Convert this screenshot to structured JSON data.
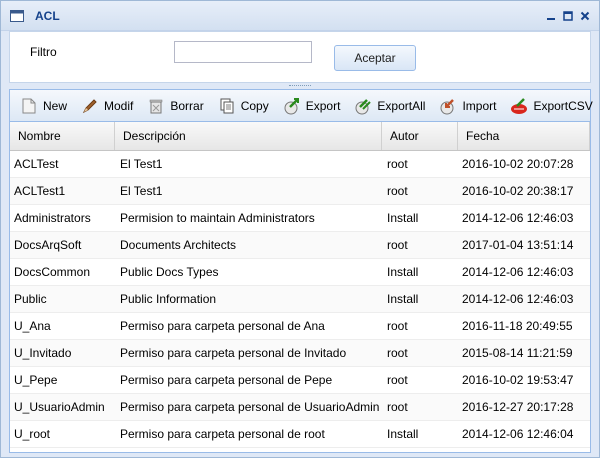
{
  "window": {
    "title": "ACL"
  },
  "filter": {
    "label": "Filtro",
    "value": "",
    "accept_label": "Aceptar"
  },
  "toolbar": {
    "buttons": [
      {
        "label": "New",
        "icon": "new-document-icon"
      },
      {
        "label": "Modif",
        "icon": "pencil-icon"
      },
      {
        "label": "Borrar",
        "icon": "delete-icon"
      },
      {
        "label": "Copy",
        "icon": "copy-icon"
      },
      {
        "label": "Export",
        "icon": "export-icon"
      },
      {
        "label": "ExportAll",
        "icon": "export-all-icon"
      },
      {
        "label": "Import",
        "icon": "import-icon"
      },
      {
        "label": "ExportCSV",
        "icon": "export-csv-icon"
      }
    ]
  },
  "grid": {
    "columns": [
      "Nombre",
      "Descripción",
      "Autor",
      "Fecha"
    ],
    "rows": [
      [
        "ACLTest",
        "El Test1",
        "root",
        "2016-10-02 20:07:28"
      ],
      [
        "ACLTest1",
        "El Test1",
        "root",
        "2016-10-02 20:38:17"
      ],
      [
        "Administrators",
        "Permision to maintain Administrators",
        "Install",
        "2014-12-06 12:46:03"
      ],
      [
        "DocsArqSoft",
        "Documents Architects",
        "root",
        "2017-01-04 13:51:14"
      ],
      [
        "DocsCommon",
        "Public Docs Types",
        "Install",
        "2014-12-06 12:46:03"
      ],
      [
        "Public",
        "Public Information",
        "Install",
        "2014-12-06 12:46:03"
      ],
      [
        "U_Ana",
        "Permiso para carpeta personal de Ana",
        "root",
        "2016-11-18 20:49:55"
      ],
      [
        "U_Invitado",
        "Permiso para carpeta personal de Invitado",
        "root",
        "2015-08-14 11:21:59"
      ],
      [
        "U_Pepe",
        "Permiso para carpeta personal de Pepe",
        "root",
        "2016-10-02 19:53:47"
      ],
      [
        "U_UsuarioAdmin",
        "Permiso para carpeta personal de UsuarioAdmin",
        "root",
        "2016-12-27 20:17:28"
      ],
      [
        "U_root",
        "Permiso para carpeta personal de root",
        "Install",
        "2014-12-06 12:46:04"
      ]
    ]
  }
}
